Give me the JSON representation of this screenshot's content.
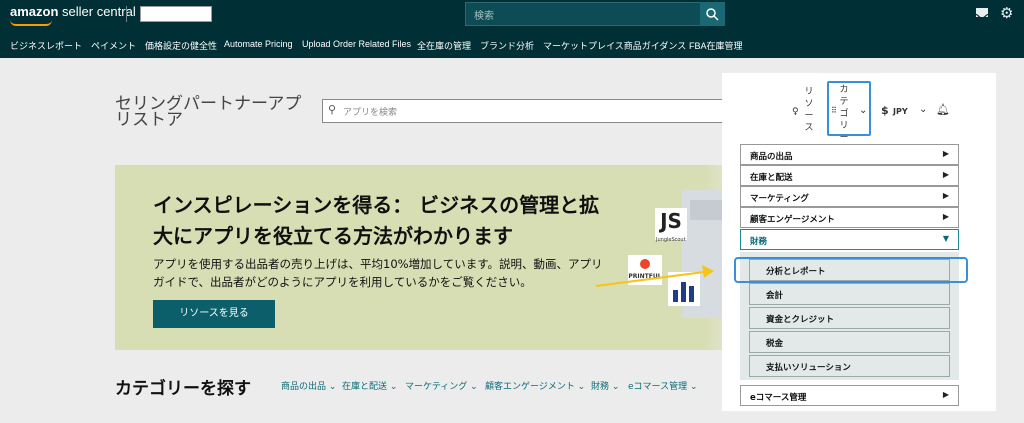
{
  "header": {
    "logo_brand": "amazon",
    "logo_rest": " seller central",
    "search_placeholder": "検索"
  },
  "nav": {
    "items": [
      "ビジネスレポート",
      "ペイメント",
      "価格設定の健全性",
      "Automate Pricing",
      "Upload Order Related Files",
      "全在庫の管理",
      "ブランド分析",
      "マーケットプレイス商品ガイダンス",
      "FBA在庫管理"
    ]
  },
  "page": {
    "title_line1": "セリングパートナーアプ",
    "title_line2": "リストア",
    "app_search_placeholder": "アプリを検索"
  },
  "hero": {
    "title_line1": "インスピレーションを得る： ビジネスの管理と拡",
    "title_line2": "大にアプリを役立てる方法がわかります",
    "text_line1": "アプリを使用する出品者の売り上げは、平均10%増加しています。説明、動画、アプリ",
    "text_line2": "ガイドで、出品者がどのようにアプリを利用しているかをご覧ください。",
    "button_label": "リソースを見る",
    "illus_js": "JS",
    "illus_js_sub": "JungleScout",
    "illus_printful": "PRINTFUL"
  },
  "categories": {
    "title": "カテゴリーを探す",
    "links": [
      "商品の出品 ⌄",
      "在庫と配送 ⌄",
      "マーケティング ⌄",
      "顧客エンゲージメント ⌄",
      "財務 ⌄",
      "eコマース管理 ⌄"
    ]
  },
  "toolbar": {
    "resources_label": "リソース",
    "category_label": "カテゴリー",
    "currency_symbol": "$",
    "currency_label": "JPY"
  },
  "dropdown": {
    "items": [
      "商品の出品",
      "在庫と配送",
      "マーケティング",
      "顧客エンゲージメント",
      "財務",
      "eコマース管理"
    ],
    "finance_sub": [
      "分析とレポート",
      "会計",
      "資金とクレジット",
      "税金",
      "支払いソリューション"
    ]
  },
  "colors": {
    "header_bg": "#002f36",
    "accent": "#0a5f6a",
    "highlight": "#3a8fd8",
    "hero_bg": "#d8deb4"
  }
}
